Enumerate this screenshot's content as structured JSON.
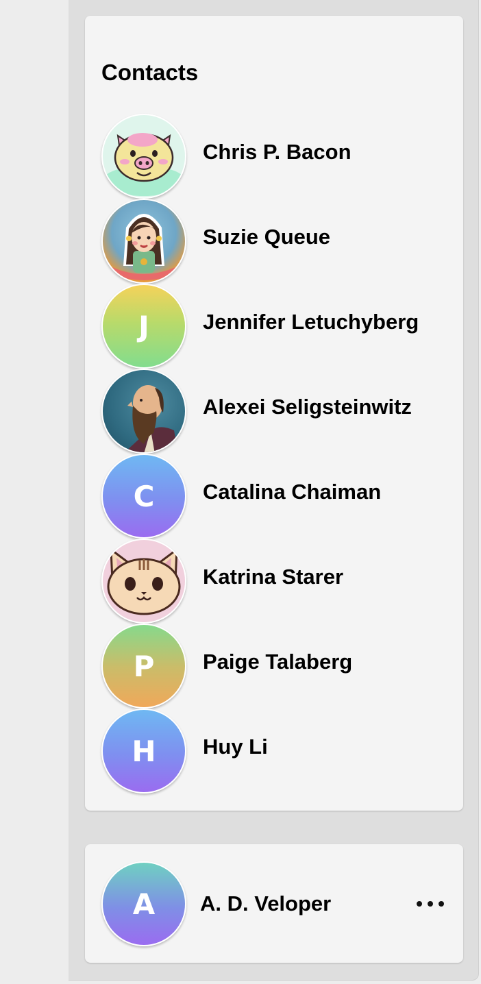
{
  "contacts_panel": {
    "title": "Contacts",
    "contacts": [
      {
        "name": "Chris P. Bacon",
        "avatar": "pig-icon"
      },
      {
        "name": "Suzie Queue",
        "avatar": "girl-icon"
      },
      {
        "name": "Jennifer Letuchyberg",
        "avatar_letter": "J"
      },
      {
        "name": "Alexei Seligsteinwitz",
        "avatar": "bearded-man-icon"
      },
      {
        "name": "Catalina Chaiman",
        "avatar_letter": "C"
      },
      {
        "name": "Katrina Starer",
        "avatar": "cat-icon"
      },
      {
        "name": "Paige Talaberg",
        "avatar_letter": "P"
      },
      {
        "name": "Huy Li",
        "avatar_letter": "H"
      }
    ]
  },
  "current_user": {
    "name": "A. D. Veloper",
    "avatar_letter": "A",
    "more_icon": "more-options-icon"
  },
  "colors": {
    "card_background": "#f4f4f4",
    "panel_background": "#dedede",
    "text": "#000000"
  }
}
